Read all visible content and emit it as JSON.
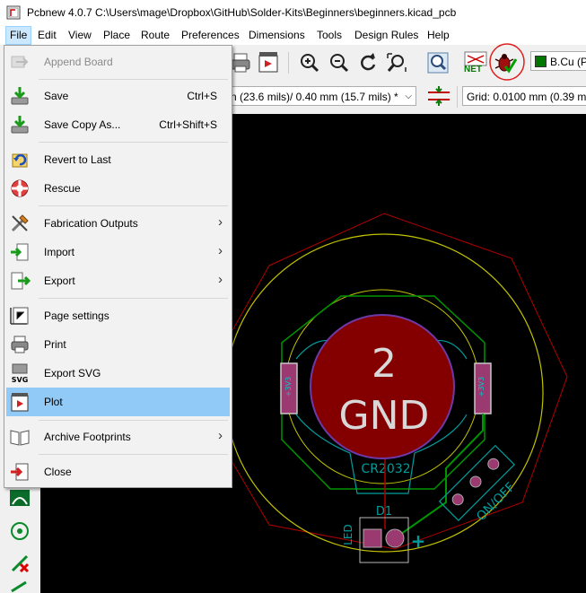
{
  "window": {
    "title": "Pcbnew 4.0.7 C:\\Users\\mage\\Dropbox\\GitHub\\Solder-Kits\\Beginners\\beginners.kicad_pcb"
  },
  "menubar": {
    "items": [
      "File",
      "Edit",
      "View",
      "Place",
      "Route",
      "Preferences",
      "Dimensions",
      "Tools",
      "Design Rules",
      "Help"
    ],
    "active": "File"
  },
  "toolbar": {
    "net_label": "NET",
    "layer_select": "B.Cu (P"
  },
  "toolbar2": {
    "track_width": "n (23.6 mils)/ 0.40 mm (15.7 mils) *",
    "grid": "Grid: 0.0100 mm (0.39 mi"
  },
  "file_menu": {
    "items": [
      {
        "label": "Append Board",
        "shortcut": "",
        "submenu": false,
        "disabled": true,
        "icon": "append-board-icon"
      },
      {
        "label": "Save",
        "shortcut": "Ctrl+S",
        "submenu": false,
        "disabled": false,
        "icon": "save-icon"
      },
      {
        "label": "Save Copy As...",
        "shortcut": "Ctrl+Shift+S",
        "submenu": false,
        "disabled": false,
        "icon": "save-copy-icon"
      },
      {
        "label": "Revert to Last",
        "shortcut": "",
        "submenu": false,
        "disabled": false,
        "icon": "revert-icon"
      },
      {
        "label": "Rescue",
        "shortcut": "",
        "submenu": false,
        "disabled": false,
        "icon": "rescue-icon"
      },
      {
        "label": "Fabrication Outputs",
        "shortcut": "",
        "submenu": true,
        "disabled": false,
        "icon": "fabrication-icon"
      },
      {
        "label": "Import",
        "shortcut": "",
        "submenu": true,
        "disabled": false,
        "icon": "import-icon"
      },
      {
        "label": "Export",
        "shortcut": "",
        "submenu": true,
        "disabled": false,
        "icon": "export-icon"
      },
      {
        "label": "Page settings",
        "shortcut": "",
        "submenu": false,
        "disabled": false,
        "icon": "page-settings-icon"
      },
      {
        "label": "Print",
        "shortcut": "",
        "submenu": false,
        "disabled": false,
        "icon": "print-icon"
      },
      {
        "label": "Export SVG",
        "shortcut": "",
        "submenu": false,
        "disabled": false,
        "icon": "svg-icon"
      },
      {
        "label": "Plot",
        "shortcut": "",
        "submenu": false,
        "disabled": false,
        "highlighted": true,
        "icon": "plot-icon"
      },
      {
        "label": "Archive Footprints",
        "shortcut": "",
        "submenu": true,
        "disabled": false,
        "icon": "archive-icon"
      },
      {
        "label": "Close",
        "shortcut": "",
        "submenu": false,
        "disabled": false,
        "icon": "close-icon"
      }
    ]
  },
  "pcb": {
    "pad_number": "2",
    "pad_net": "GND",
    "battery_ref": "CR2032",
    "led_ref": "D1",
    "led_label": "LED",
    "plus_sign": "+",
    "switch_label": "ON/OFF",
    "pin_left": "+3V3",
    "pin_right": "+3V3"
  },
  "colors": {
    "board_bg": "#000000",
    "pad_red": "#840000",
    "outline_yellow": "#c2c200",
    "silk_teal": "#009c9c",
    "track_green": "#009400",
    "highlight": "#91c9f7"
  }
}
